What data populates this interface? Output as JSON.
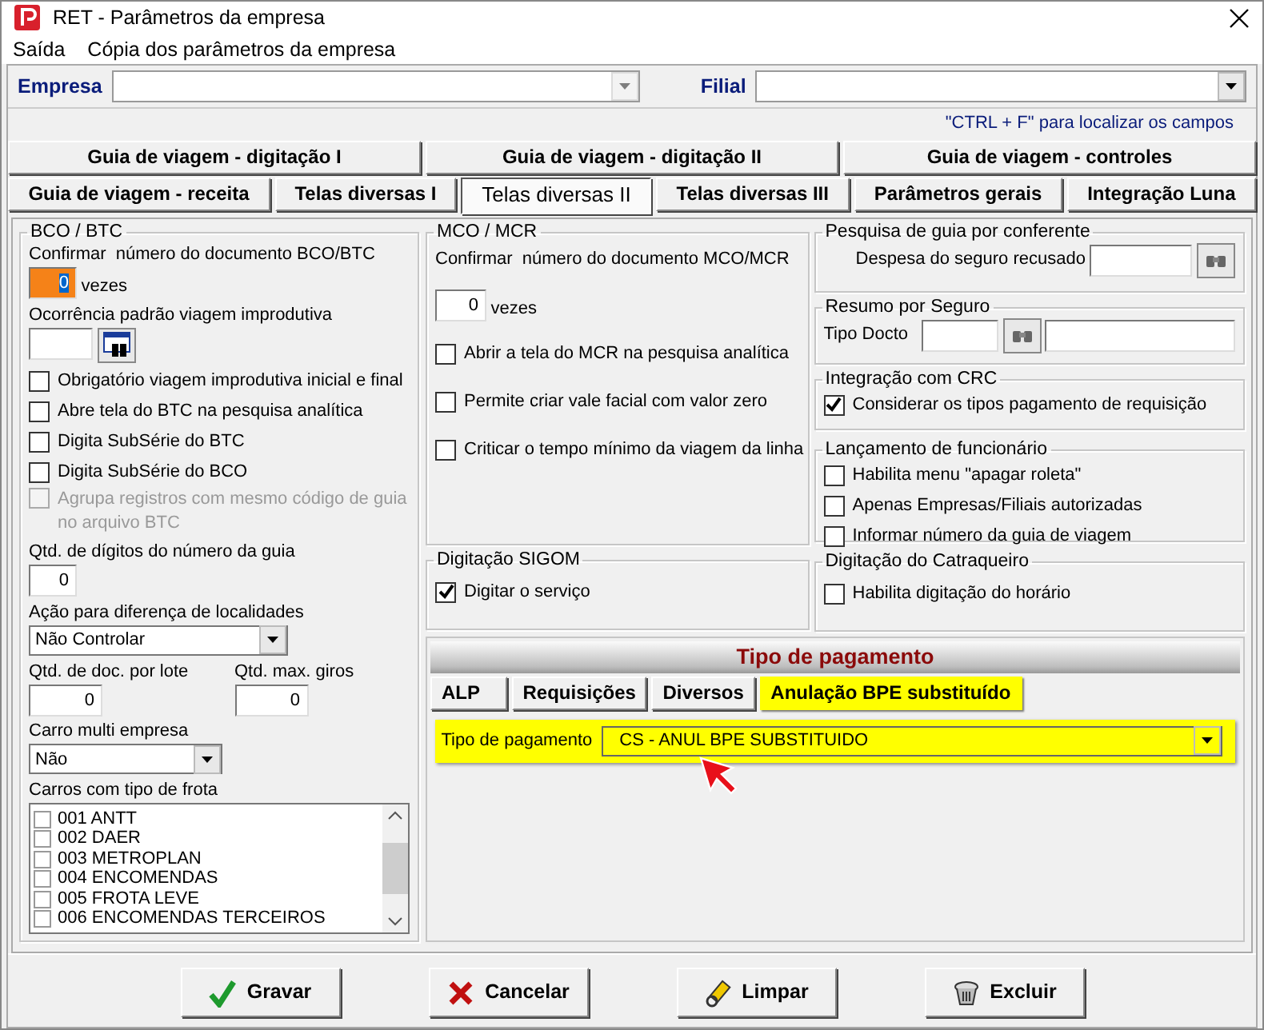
{
  "window": {
    "title": "RET - Parâmetros da empresa"
  },
  "menu": [
    {
      "label": "Saída"
    },
    {
      "label": "Cópia dos parâmetros da empresa"
    }
  ],
  "company": {
    "empresa_label": "Empresa",
    "filial_label": "Filial",
    "hint": "\"CTRL + F\" para localizar os campos"
  },
  "tab_rows": [
    [
      {
        "label": "Guia de viagem - digitação I",
        "selected": false
      },
      {
        "label": "Guia de viagem - digitação II",
        "selected": false
      },
      {
        "label": "Guia de viagem - controles",
        "selected": false
      }
    ],
    [
      {
        "label": "Guia de viagem - receita",
        "selected": false
      },
      {
        "label": "Telas diversas I",
        "selected": false
      },
      {
        "label": "Telas diversas II",
        "selected": true
      },
      {
        "label": "Telas diversas III",
        "selected": false
      },
      {
        "label": "Parâmetros gerais",
        "selected": false
      },
      {
        "label": "Integração Luna",
        "selected": false
      }
    ]
  ],
  "bco_btc": {
    "title": "BCO / BTC",
    "confirm_label": "Confirmar  número do documento BCO/BTC",
    "confirm_value": "0",
    "confirm_focused": true,
    "confirm_unit": "vezes",
    "ocorrencia_label": "Ocorrência padrão viagem improdutiva",
    "checkboxes": [
      {
        "label": "Obrigatório viagem improdutiva inicial e final",
        "checked": false,
        "disabled": false
      },
      {
        "label": "Abre tela do BTC na pesquisa analítica",
        "checked": false,
        "disabled": false
      },
      {
        "label": "Digita SubSérie do BTC",
        "checked": false,
        "disabled": false
      },
      {
        "label": "Digita SubSérie do BCO",
        "checked": false,
        "disabled": false
      },
      {
        "label": "Agrupa registros com mesmo código de guia no arquivo BTC",
        "checked": false,
        "disabled": true
      }
    ],
    "digits_label": "Qtd. de dígitos do número da guia",
    "digits_value": "0",
    "action_label": "Ação para diferença de localidades",
    "action_value": "Não Controlar",
    "batch_label": "Qtd. de doc. por lote",
    "batch_value": "0",
    "turns_label": "Qtd. max. giros",
    "turns_value": "0",
    "multi_label": "Carro multi empresa",
    "multi_value": "Não",
    "fleet_label": "Carros com tipo de frota",
    "fleet": [
      {
        "label": "001 ANTT",
        "checked": false
      },
      {
        "label": "002 DAER",
        "checked": false
      },
      {
        "label": "003 METROPLAN",
        "checked": false
      },
      {
        "label": "004 ENCOMENDAS",
        "checked": false
      },
      {
        "label": "005 FROTA LEVE",
        "checked": false
      },
      {
        "label": "006 ENCOMENDAS TERCEIROS",
        "checked": false
      }
    ]
  },
  "mco_mcr": {
    "title": "MCO / MCR",
    "confirm_label": "Confirmar  número do documento MCO/MCR",
    "confirm_value": "0",
    "confirm_unit": "vezes",
    "checkboxes": [
      {
        "label": "Abrir a tela do MCR na pesquisa analítica",
        "checked": false
      },
      {
        "label": "Permite criar vale facial com valor zero",
        "checked": false
      },
      {
        "label": "Criticar o tempo mínimo da viagem da linha",
        "checked": false
      }
    ]
  },
  "pesquisa": {
    "title": "Pesquisa de guia por conferente",
    "label": "Despesa do seguro recusado"
  },
  "resumo": {
    "title": "Resumo por Seguro",
    "label": "Tipo Docto"
  },
  "crc": {
    "title": "Integração com CRC",
    "checkboxes": [
      {
        "label": "Considerar os tipos pagamento de requisição",
        "checked": true
      }
    ]
  },
  "lancamento": {
    "title": "Lançamento de funcionário",
    "checkboxes": [
      {
        "label": "Habilita menu \"apagar roleta\"",
        "checked": false
      },
      {
        "label": "Apenas Empresas/Filiais autorizadas",
        "checked": false
      },
      {
        "label": "Informar número da guia de viagem",
        "checked": false
      }
    ]
  },
  "sigom": {
    "title": "Digitação SIGOM",
    "checkboxes": [
      {
        "label": "Digitar o serviço",
        "checked": true
      }
    ]
  },
  "catraqueiro": {
    "title": "Digitação do Catraqueiro",
    "checkboxes": [
      {
        "label": "Habilita digitação do horário",
        "checked": false
      }
    ]
  },
  "tipo_pagamento": {
    "title": "Tipo de pagamento",
    "tabs": [
      {
        "label": "ALP",
        "selected": false
      },
      {
        "label": "Requisições",
        "selected": false
      },
      {
        "label": "Diversos",
        "selected": false
      },
      {
        "label": "Anulação BPE substituído",
        "selected": true
      }
    ],
    "field_label": "Tipo de pagamento",
    "field_value": "CS - ANUL BPE SUBSTITUIDO"
  },
  "buttons": [
    {
      "label": "Gravar",
      "kind": "save"
    },
    {
      "label": "Cancelar",
      "kind": "cancel"
    },
    {
      "label": "Limpar",
      "kind": "clear"
    },
    {
      "label": "Excluir",
      "kind": "delete"
    }
  ]
}
